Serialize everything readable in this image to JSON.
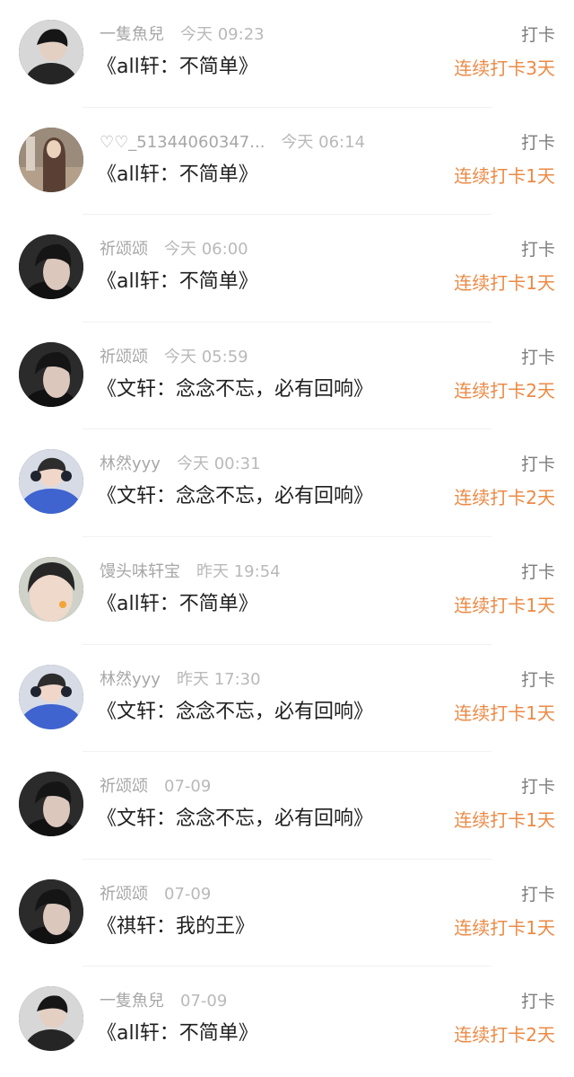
{
  "action_label": "打卡",
  "colors": {
    "streak": "#ec8a45",
    "username": "#a7a7a7",
    "time": "#b9b9b9",
    "book": "#1f1f1f"
  },
  "entries": [
    {
      "avatar": "boy-dark-jacket-avatar",
      "username": "一隻魚兒",
      "time": "今天 09:23",
      "book": "《all轩：不简单》",
      "streak": "连续打卡3天"
    },
    {
      "avatar": "girl-long-hair-avatar",
      "username": "♡♡_51344060347...",
      "time": "今天 06:14",
      "book": "《all轩：不简单》",
      "streak": "连续打卡1天"
    },
    {
      "avatar": "boy-dark-portrait-avatar",
      "username": "祈颂颂",
      "time": "今天 06:00",
      "book": "《all轩：不简单》",
      "streak": "连续打卡1天"
    },
    {
      "avatar": "boy-dark-portrait-avatar",
      "username": "祈颂颂",
      "time": "今天 05:59",
      "book": "《文轩：念念不忘，必有回响》",
      "streak": "连续打卡2天"
    },
    {
      "avatar": "boy-blue-sweater-avatar",
      "username": "林然yyy",
      "time": "今天 00:31",
      "book": "《文轩：念念不忘，必有回响》",
      "streak": "连续打卡2天"
    },
    {
      "avatar": "boy-closeup-avatar",
      "username": "馒头味轩宝",
      "time": "昨天 19:54",
      "book": "《all轩：不简单》",
      "streak": "连续打卡1天"
    },
    {
      "avatar": "boy-blue-sweater-avatar",
      "username": "林然yyy",
      "time": "昨天 17:30",
      "book": "《文轩：念念不忘，必有回响》",
      "streak": "连续打卡1天"
    },
    {
      "avatar": "boy-dark-portrait-avatar",
      "username": "祈颂颂",
      "time": "07-09",
      "book": "《文轩：念念不忘，必有回响》",
      "streak": "连续打卡1天"
    },
    {
      "avatar": "boy-dark-portrait-avatar",
      "username": "祈颂颂",
      "time": "07-09",
      "book": "《祺轩：我的王》",
      "streak": "连续打卡1天"
    },
    {
      "avatar": "boy-dark-jacket-avatar",
      "username": "一隻魚兒",
      "time": "07-09",
      "book": "《all轩：不简单》",
      "streak": "连续打卡2天"
    }
  ]
}
